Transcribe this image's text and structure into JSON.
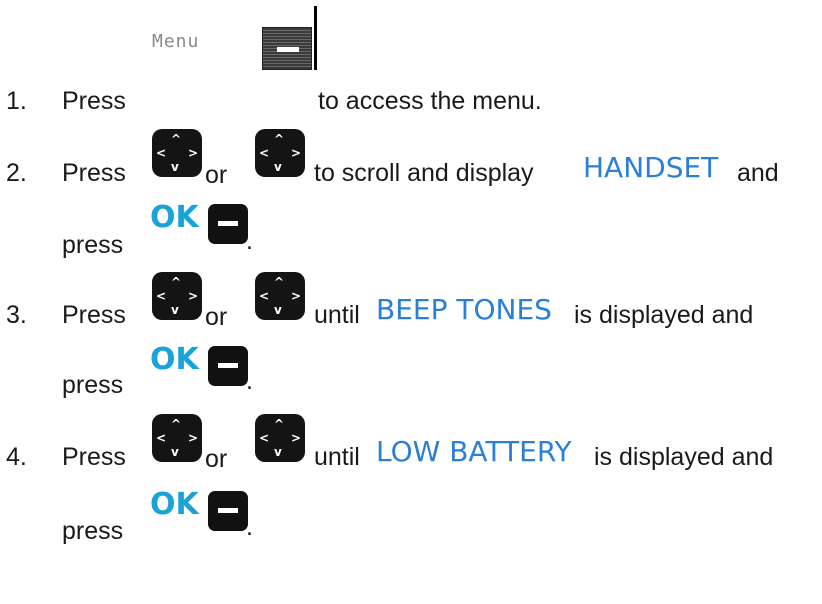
{
  "icons": {
    "menu_key": "menu-softkey-icon",
    "nav_key": "navigation-key-icon",
    "ok_key": "ok-softkey-icon"
  },
  "colors": {
    "display_text": "#2a7fd6",
    "ok_label": "#1aa3d9",
    "key_body": "#141414"
  },
  "menu_label": "Menu",
  "ok_label": "OK",
  "steps": [
    {
      "number": "1.",
      "press": "Press",
      "after": "to access the menu."
    },
    {
      "number": "2.",
      "press": "Press",
      "or": "or",
      "middle": "to scroll and display",
      "display": "HANDSET",
      "tail": "and",
      "press2": "press",
      "end": "."
    },
    {
      "number": "3.",
      "press": "Press",
      "or": "or",
      "middle": "until",
      "display": "BEEP TONES",
      "tail": "is displayed and",
      "press2": "press",
      "end": "."
    },
    {
      "number": "4.",
      "press": "Press",
      "or": "or",
      "middle": "until",
      "display": "LOW BATTERY",
      "tail": "is displayed and",
      "press2": "press",
      "end": "."
    }
  ]
}
